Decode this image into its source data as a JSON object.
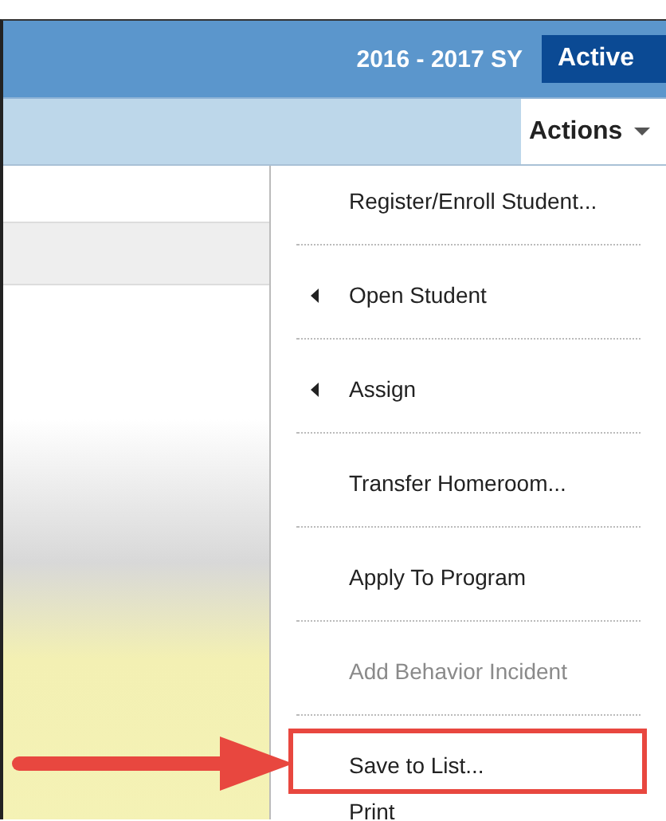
{
  "header": {
    "school_year": "2016 - 2017 SY",
    "status": "Active"
  },
  "toolbar": {
    "actions_label": "Actions"
  },
  "menu": [
    {
      "label": "Register/Enroll Student...",
      "kind": "action",
      "disabled": false,
      "highlighted": false,
      "separator": true
    },
    {
      "label": "Open Student",
      "kind": "submenu",
      "disabled": false,
      "highlighted": false,
      "separator": true
    },
    {
      "label": "Assign",
      "kind": "submenu",
      "disabled": false,
      "highlighted": false,
      "separator": true
    },
    {
      "label": "Transfer Homeroom...",
      "kind": "action",
      "disabled": false,
      "highlighted": false,
      "separator": true
    },
    {
      "label": "Apply To Program",
      "kind": "action",
      "disabled": false,
      "highlighted": false,
      "separator": true
    },
    {
      "label": "Add Behavior Incident",
      "kind": "action",
      "disabled": true,
      "highlighted": false,
      "separator": true
    },
    {
      "label": "Save to List...",
      "kind": "action",
      "disabled": false,
      "highlighted": true,
      "separator": false
    },
    {
      "label": "Print",
      "kind": "action",
      "disabled": false,
      "highlighted": false,
      "separator": false
    }
  ]
}
